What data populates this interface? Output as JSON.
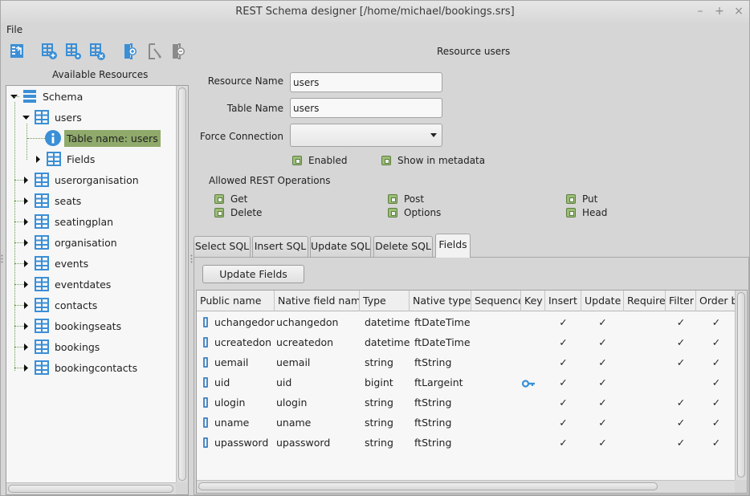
{
  "window": {
    "title": "REST Schema designer [/home/michael/bookings.srs]",
    "controls": {
      "minimize": "–",
      "maximize": "+",
      "close": "×"
    }
  },
  "menu": {
    "file": "File"
  },
  "toolbar": {
    "buttons": [
      {
        "icon": "import-icon",
        "tooltip": ""
      },
      {
        "icon": "add-table-icon",
        "tooltip": ""
      },
      {
        "icon": "table-settings-icon",
        "tooltip": ""
      },
      {
        "icon": "delete-table-icon",
        "tooltip": ""
      },
      {
        "icon": "add-resource-icon",
        "tooltip": ""
      },
      {
        "icon": "edit-resource-icon",
        "tooltip": ""
      },
      {
        "icon": "remove-resource-icon",
        "tooltip": ""
      }
    ]
  },
  "left_panel": {
    "title": "Available Resources",
    "tree": {
      "root": "Schema",
      "expanded_node": "users",
      "expanded_children": [
        {
          "label": "Table name: users",
          "icon": "info-icon",
          "selected": true
        },
        {
          "label": "Fields",
          "icon": "table-icon",
          "selected": false
        }
      ],
      "nodes": [
        "users",
        "userorganisation",
        "seats",
        "seatingplan",
        "organisation",
        "events",
        "eventdates",
        "contacts",
        "bookingseats",
        "bookings",
        "bookingcontacts"
      ]
    }
  },
  "resource": {
    "heading": "Resource users",
    "resource_name_label": "Resource Name",
    "resource_name_value": "users",
    "table_name_label": "Table Name",
    "table_name_value": "users",
    "force_connection_label": "Force Connection",
    "force_connection_value": "",
    "enabled_label": "Enabled",
    "enabled_checked": true,
    "show_in_metadata_label": "Show in metadata",
    "show_in_metadata_checked": true,
    "allowed_ops_label": "Allowed REST Operations",
    "ops": [
      {
        "label": "Get",
        "checked": true
      },
      {
        "label": "Delete",
        "checked": true
      },
      {
        "label": "Post",
        "checked": true
      },
      {
        "label": "Options",
        "checked": true
      },
      {
        "label": "Put",
        "checked": true
      },
      {
        "label": "Head",
        "checked": true
      }
    ]
  },
  "tabs": {
    "items": [
      "Select SQL",
      "Insert SQL",
      "Update SQL",
      "Delete SQL",
      "Fields"
    ],
    "active": "Fields"
  },
  "fields_tab": {
    "update_button": "Update Fields",
    "columns": [
      "Public name",
      "Native field name",
      "Type",
      "Native type",
      "Sequence",
      "Key",
      "Insert",
      "Update",
      "Require",
      "Filter",
      "Order by"
    ],
    "check_glyph": "✓",
    "rows": [
      {
        "public": "uchangedon",
        "native": "uchangedon",
        "type": "datetime",
        "native_type": "ftDateTime",
        "sequence": "",
        "key": false,
        "insert": true,
        "update": true,
        "require": false,
        "filter": true,
        "order_by": true
      },
      {
        "public": "ucreatedon",
        "native": "ucreatedon",
        "type": "datetime",
        "native_type": "ftDateTime",
        "sequence": "",
        "key": false,
        "insert": true,
        "update": true,
        "require": false,
        "filter": true,
        "order_by": true
      },
      {
        "public": "uemail",
        "native": "uemail",
        "type": "string",
        "native_type": "ftString",
        "sequence": "",
        "key": false,
        "insert": true,
        "update": true,
        "require": false,
        "filter": true,
        "order_by": true
      },
      {
        "public": "uid",
        "native": "uid",
        "type": "bigint",
        "native_type": "ftLargeint",
        "sequence": "",
        "key": true,
        "insert": true,
        "update": true,
        "require": false,
        "filter": false,
        "order_by": true
      },
      {
        "public": "ulogin",
        "native": "ulogin",
        "type": "string",
        "native_type": "ftString",
        "sequence": "",
        "key": false,
        "insert": true,
        "update": true,
        "require": false,
        "filter": true,
        "order_by": true
      },
      {
        "public": "uname",
        "native": "uname",
        "type": "string",
        "native_type": "ftString",
        "sequence": "",
        "key": false,
        "insert": true,
        "update": true,
        "require": false,
        "filter": true,
        "order_by": true
      },
      {
        "public": "upassword",
        "native": "upassword",
        "type": "string",
        "native_type": "ftString",
        "sequence": "",
        "key": false,
        "insert": true,
        "update": true,
        "require": false,
        "filter": true,
        "order_by": true
      }
    ]
  },
  "colors": {
    "accent_blue": "#3b8fd6",
    "selection_green": "#8faa6b",
    "checkbox_green": "#9cbd78"
  }
}
